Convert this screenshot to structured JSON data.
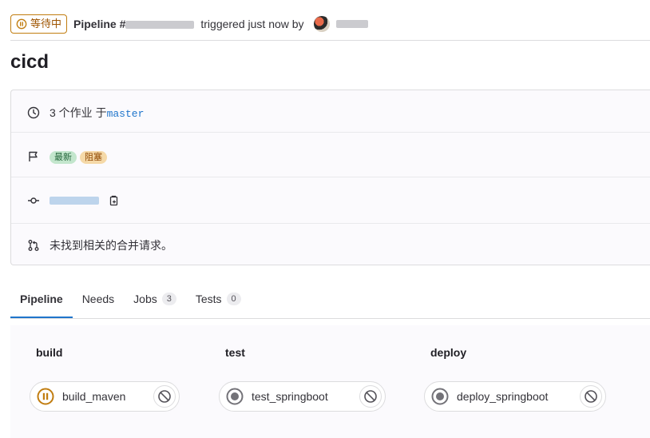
{
  "header": {
    "status_label": "等待中",
    "pipeline_prefix": "Pipeline #",
    "triggered_text": "triggered just now by"
  },
  "title": "cicd",
  "info": {
    "jobs_text": "3 个作业 于",
    "branch": "master",
    "badges": [
      "最新",
      "阻塞"
    ],
    "merge_request_text": "未找到相关的合并请求。"
  },
  "tabs": [
    {
      "label": "Pipeline"
    },
    {
      "label": "Needs"
    },
    {
      "label": "Jobs",
      "count": "3"
    },
    {
      "label": "Tests",
      "count": "0"
    }
  ],
  "stages": [
    {
      "title": "build",
      "job": "build_maven",
      "status": "paused"
    },
    {
      "title": "test",
      "job": "test_springboot",
      "status": "created"
    },
    {
      "title": "deploy",
      "job": "deploy_springboot",
      "status": "created"
    }
  ],
  "colors": {
    "paused": "#c17d10",
    "link": "#1f75cb"
  }
}
